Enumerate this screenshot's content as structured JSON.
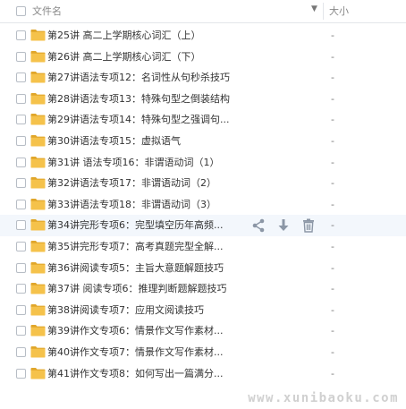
{
  "header": {
    "name_label": "文件名",
    "size_label": "大小",
    "sort_icon": "chevron-down-icon"
  },
  "files": [
    {
      "name": "第25讲 高二上学期核心词汇（上）",
      "size": "-"
    },
    {
      "name": "第26讲 高二上学期核心词汇（下）",
      "size": "-"
    },
    {
      "name": "第27讲语法专项12：名词性从句秒杀技巧",
      "size": "-"
    },
    {
      "name": "第28讲语法专项13：特殊句型之倒装结构",
      "size": "-"
    },
    {
      "name": "第29讲语法专项14：特殊句型之强调句...",
      "size": "-"
    },
    {
      "name": "第30讲语法专项15：虚拟语气",
      "size": "-"
    },
    {
      "name": "第31讲 语法专项16：非谓语动词（1）",
      "size": "-"
    },
    {
      "name": "第32讲语法专项17：非谓语动词（2）",
      "size": "-"
    },
    {
      "name": "第33讲语法专项18：非谓语动词（3）",
      "size": "-"
    },
    {
      "name": "第34讲完形专项6：完型填空历年高频...",
      "size": "-",
      "hovered": true
    },
    {
      "name": "第35讲完形专项7：高考真题完型全解...",
      "size": "-"
    },
    {
      "name": "第36讲阅读专项5：主旨大意题解题技巧",
      "size": "-"
    },
    {
      "name": "第37讲 阅读专项6：推理判断题解题技巧",
      "size": "-"
    },
    {
      "name": "第38讲阅读专项7：应用文阅读技巧",
      "size": "-"
    },
    {
      "name": "第39讲作文专项6：情景作文写作素材...",
      "size": "-"
    },
    {
      "name": "第40讲作文专项7：情景作文写作素材...",
      "size": "-"
    },
    {
      "name": "第41讲作文专项8：如何写出一篇满分...",
      "size": "-"
    }
  ],
  "row_actions": [
    "share-icon",
    "download-icon",
    "delete-icon"
  ],
  "watermark": "www.xunibaoku.com",
  "colors": {
    "folder": "#f5c24b",
    "folder_dark": "#e0a62a",
    "action_icon": "#8c97a6",
    "hover_row": "#f3f7fc"
  }
}
